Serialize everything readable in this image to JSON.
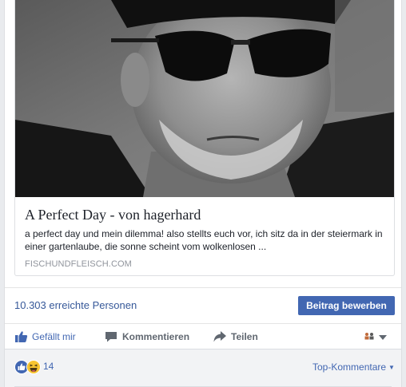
{
  "link_preview": {
    "title": "A Perfect Day - von hagerhard",
    "description": "a perfect day und mein dilemma! also stellts euch vor, ich sitz da in der steiermark in einer gartenlaube, die sonne scheint vom wolkenlosen ...",
    "domain": "FISCHUNDFLEISCH.COM",
    "image_icon": "portrait-photo"
  },
  "reach": {
    "text": "10.303 erreichte Personen",
    "promote_label": "Beitrag bewerben"
  },
  "actions": {
    "like_label": "Gefällt mir",
    "comment_label": "Kommentieren",
    "share_label": "Teilen",
    "audience_icon": "friends-icon"
  },
  "reactions": {
    "count": "14",
    "sort_label": "Top-Kommentare",
    "icons": [
      "like-reaction-icon",
      "haha-reaction-icon"
    ]
  },
  "colors": {
    "link_blue": "#365899",
    "button_blue": "#4267b2",
    "text_dark": "#1d2129",
    "muted": "#90949c"
  }
}
